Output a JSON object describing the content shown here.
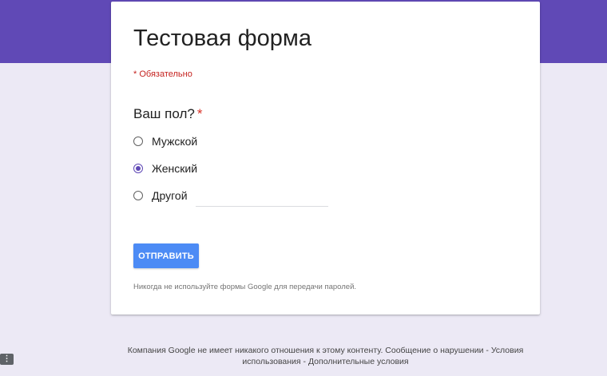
{
  "colors": {
    "header_band": "#6049b6",
    "background": "#ece9f5",
    "accent": "#6049b6",
    "required": "#d93025",
    "submit_button": "#4c8bf5"
  },
  "form": {
    "title": "Тестовая форма",
    "required_note": "* Обязательно"
  },
  "question": {
    "title": "Ваш пол?",
    "required_marker": "*",
    "options": [
      {
        "label": "Мужской",
        "selected": false
      },
      {
        "label": "Женский",
        "selected": true
      },
      {
        "label": "Другой",
        "selected": false,
        "has_text_input": true,
        "input_value": ""
      }
    ]
  },
  "submit": {
    "label": "ОТПРАВИТЬ"
  },
  "password_warning": "Никогда не используйте формы Google для передачи паролей.",
  "footer": {
    "text": "Компания Google не имеет никакого отношения к этому контенту.",
    "links": [
      "Сообщение о нарушении",
      "Условия использования",
      "Дополнительные условия"
    ],
    "separator": "-"
  },
  "corner_badge": {
    "icon": "more-vert-icon",
    "glyph": "⋮"
  }
}
